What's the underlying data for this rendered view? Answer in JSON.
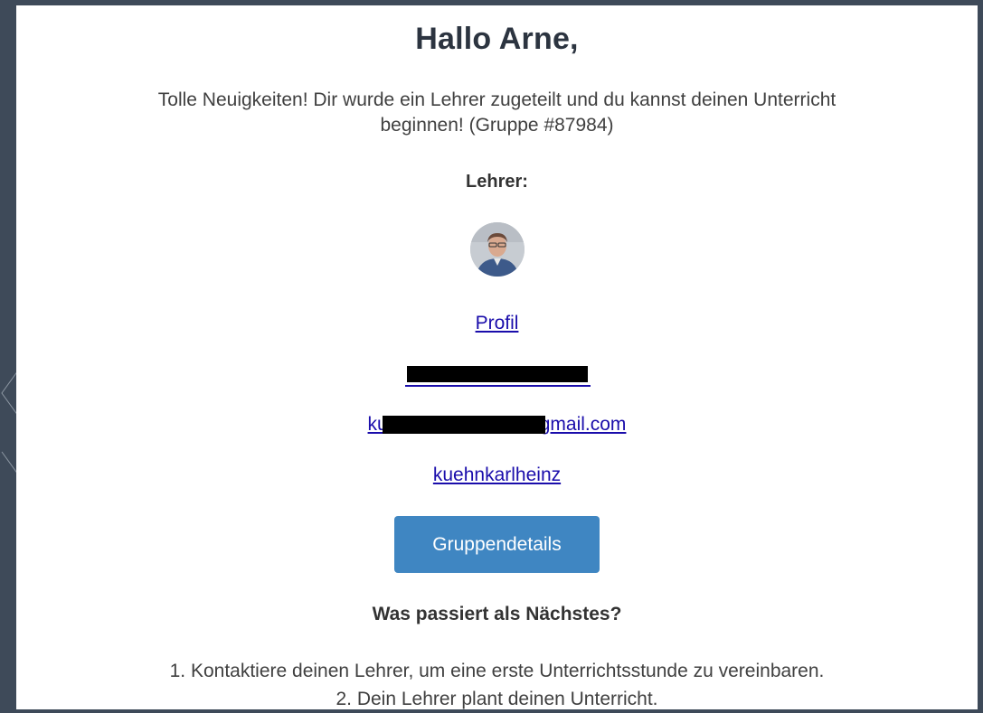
{
  "email": {
    "greeting": "Hallo Arne,",
    "intro_line1": "Tolle Neuigkeiten! Dir wurde ein Lehrer zugeteilt und du kannst deinen Unterricht",
    "intro_line2": "beginnen! (Gruppe #87984)",
    "teacher_label": "Lehrer:",
    "profile_link": "Profil",
    "email_prefix": "ku",
    "email_suffix": "gmail.com",
    "username_link": "kuehnkarlheinz",
    "group_button": "Gruppendetails",
    "next_heading": "Was passiert als Nächstes?",
    "steps": [
      "1. Kontaktiere deinen Lehrer, um eine erste Unterrichtsstunde zu vereinbaren.",
      "2. Dein Lehrer plant deinen Unterricht."
    ]
  },
  "colors": {
    "background": "#3e4a59",
    "link": "#1a0dab",
    "button": "#3f86c2",
    "title": "#2c3440"
  }
}
